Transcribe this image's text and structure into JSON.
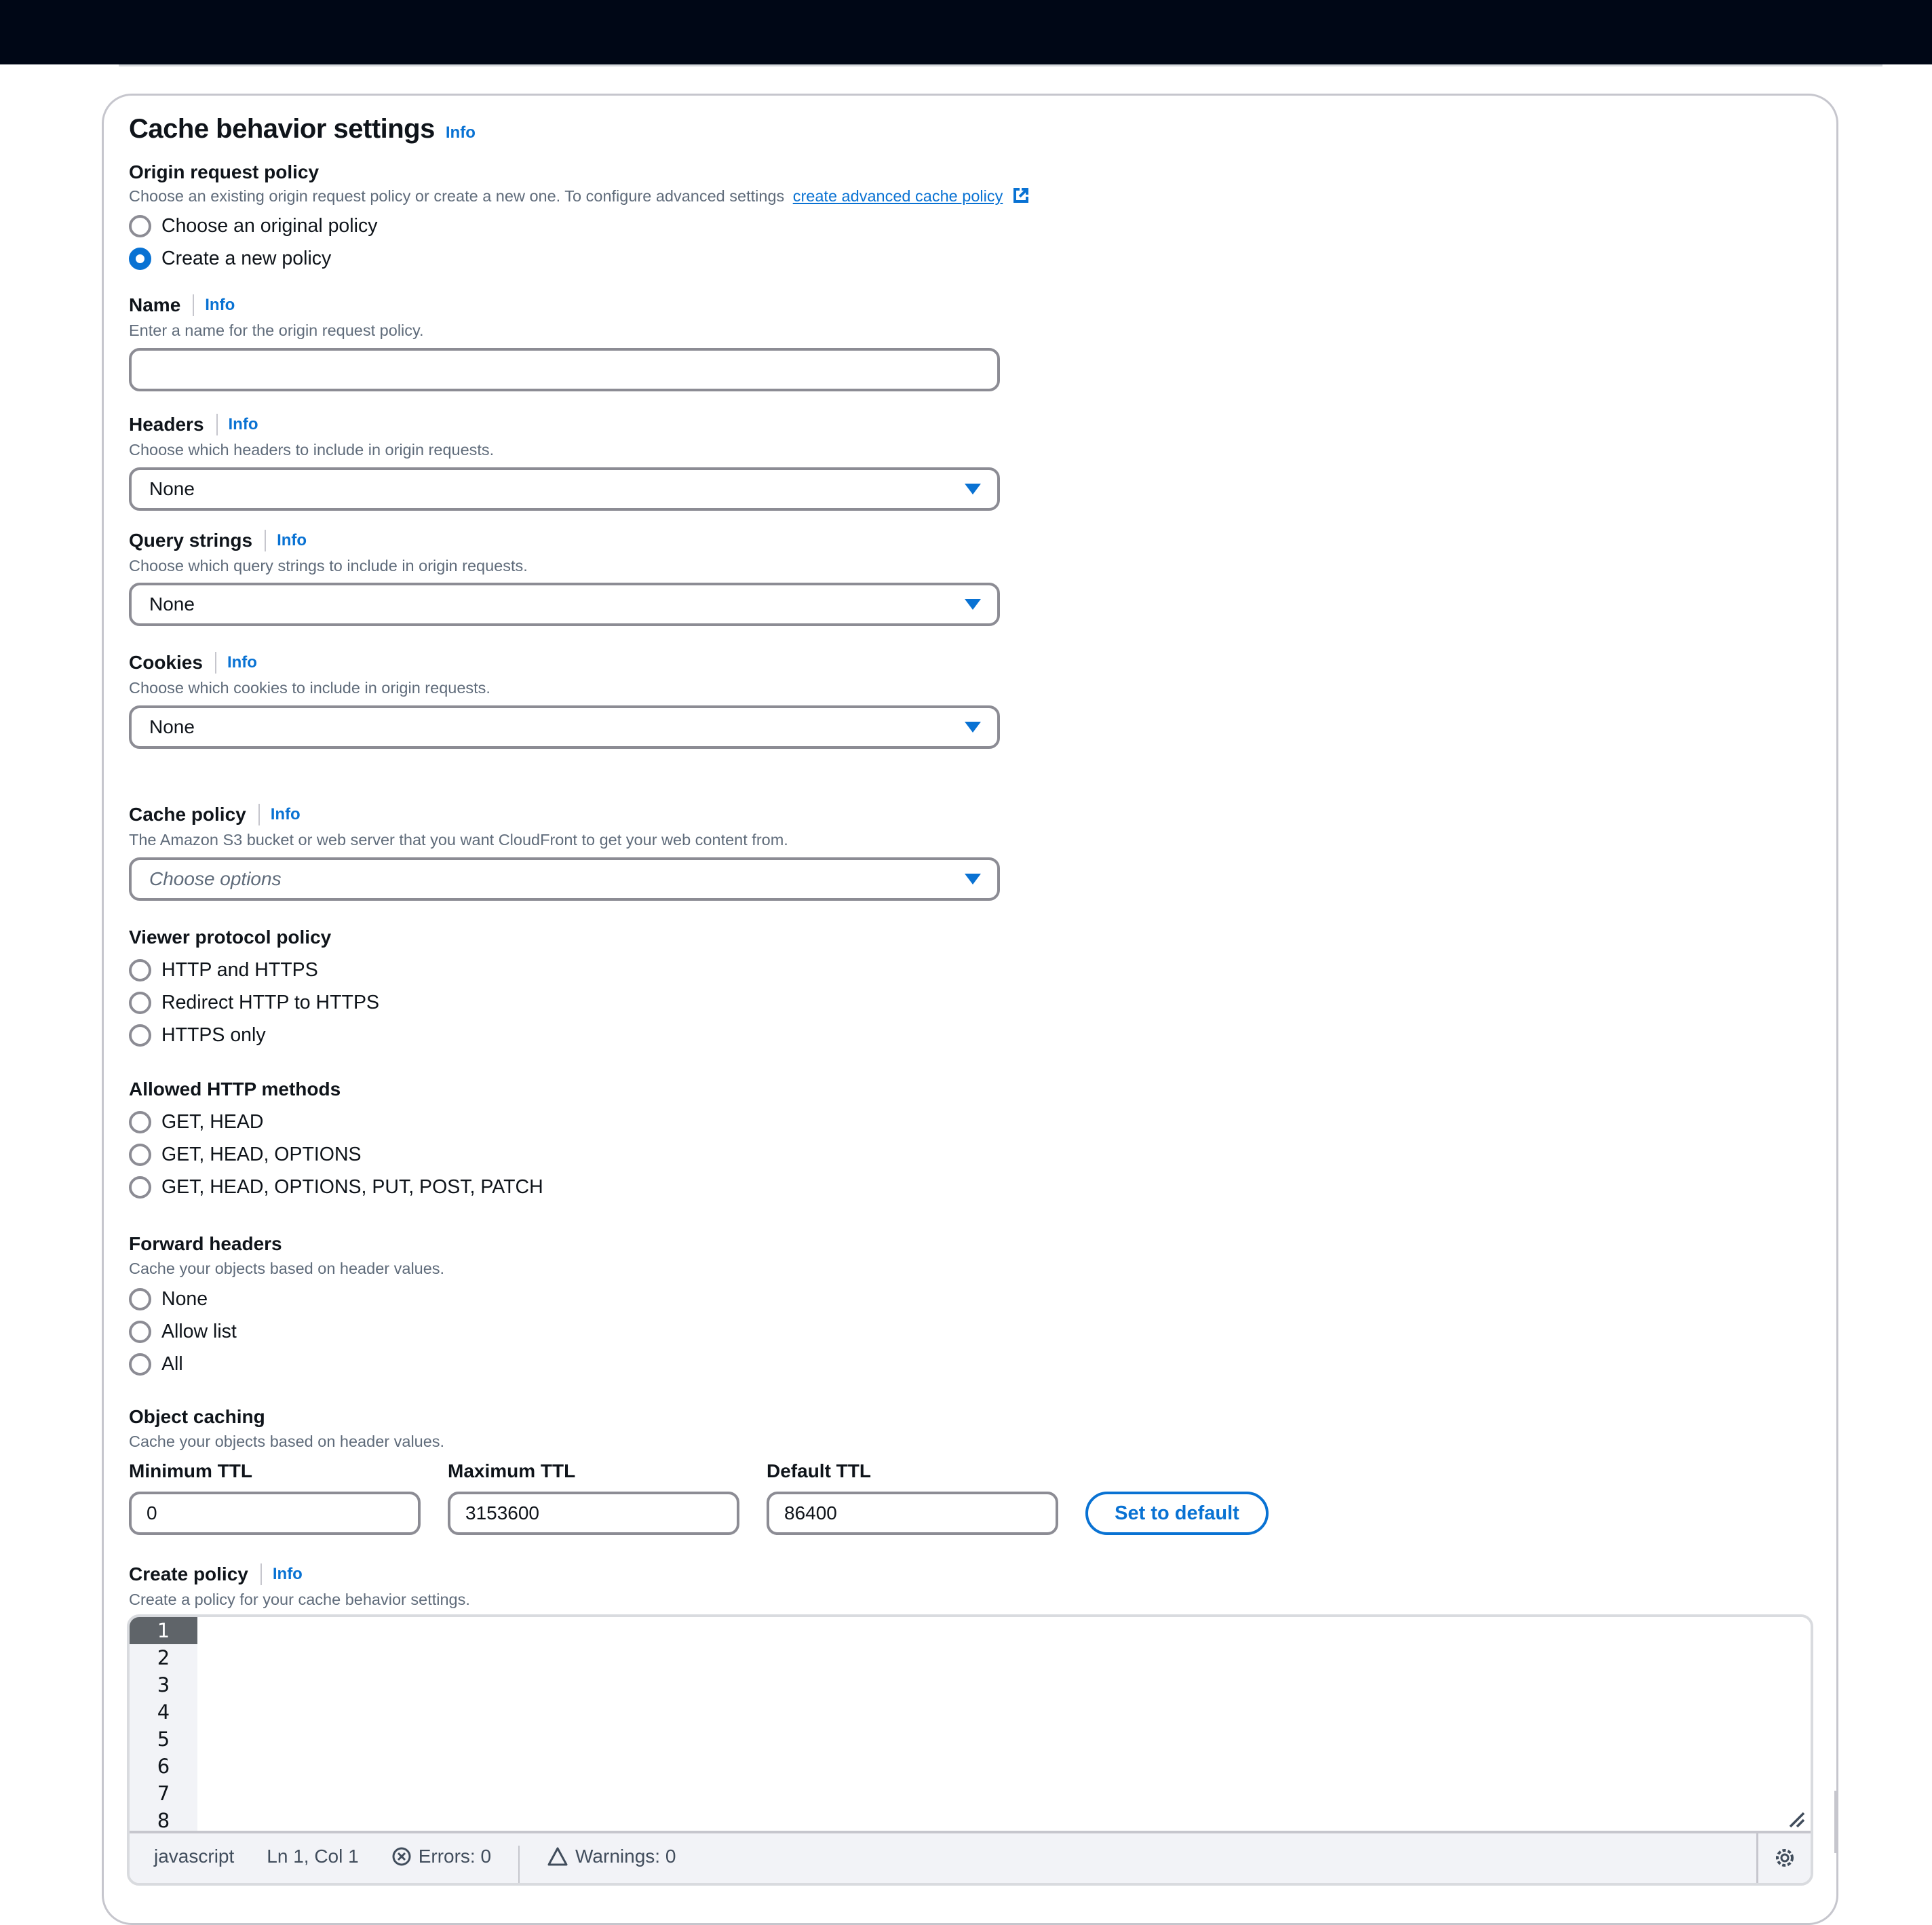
{
  "section": {
    "title": "Cache behavior settings",
    "info_label": "Info"
  },
  "origin_request_policy": {
    "label": "Origin request policy",
    "description": "Choose an existing origin request policy or create a new one. To configure advanced settings",
    "link_text": "create advanced cache policy",
    "link_icon": "external-link-icon",
    "options": [
      {
        "label": "Choose an original policy",
        "selected": false
      },
      {
        "label": "Create a new policy",
        "selected": true
      }
    ]
  },
  "name_field": {
    "label": "Name",
    "info_label": "Info",
    "description": "Enter a name for the origin request policy.",
    "value": "",
    "placeholder": ""
  },
  "headers_field": {
    "label": "Headers",
    "info_label": "Info",
    "description": "Choose which headers to include in origin requests.",
    "selected": "None",
    "icon": "caret-down-icon"
  },
  "query_strings_field": {
    "label": "Query strings",
    "info_label": "Info",
    "description": "Choose which query strings to include in origin requests.",
    "selected": "None"
  },
  "cookies_field": {
    "label": "Cookies",
    "info_label": "Info",
    "description": "Choose which cookies to include in origin requests.",
    "selected": "None"
  },
  "cache_policy_field": {
    "label": "Cache policy",
    "info_label": "Info",
    "description": "The Amazon S3 bucket or web server that you want CloudFront to get your web content from.",
    "placeholder": "Choose options"
  },
  "viewer_protocol_policy": {
    "label": "Viewer protocol policy",
    "options": [
      {
        "label": "HTTP and HTTPS",
        "selected": false
      },
      {
        "label": "Redirect HTTP to HTTPS",
        "selected": false
      },
      {
        "label": "HTTPS only",
        "selected": false
      }
    ]
  },
  "allowed_http_methods": {
    "label": "Allowed HTTP methods",
    "options": [
      {
        "label": "GET, HEAD",
        "selected": false
      },
      {
        "label": "GET, HEAD, OPTIONS",
        "selected": false
      },
      {
        "label": "GET, HEAD, OPTIONS, PUT, POST, PATCH",
        "selected": false
      }
    ]
  },
  "forward_headers": {
    "label": "Forward headers",
    "description": "Cache your objects based on header values.",
    "options": [
      {
        "label": "None",
        "selected": false
      },
      {
        "label": "Allow list",
        "selected": false
      },
      {
        "label": "All",
        "selected": false
      }
    ]
  },
  "object_caching": {
    "label": "Object caching",
    "description": "Cache your objects based on header values.",
    "min_ttl": {
      "label": "Minimum TTL",
      "value": "0"
    },
    "max_ttl": {
      "label": "Maximum TTL",
      "value": "3153600"
    },
    "default_ttl": {
      "label": "Default TTL",
      "value": "86400"
    },
    "set_default_label": "Set to default"
  },
  "create_policy": {
    "label": "Create policy",
    "info_label": "Info",
    "description": "Create a policy for your cache behavior settings.",
    "line_numbers": [
      "1",
      "2",
      "3",
      "4",
      "5",
      "6",
      "7",
      "8"
    ],
    "active_line": 1,
    "status": {
      "language": "javascript",
      "position": "Ln 1, Col 1",
      "errors_label": "Errors: 0",
      "warnings_label": "Warnings: 0"
    }
  },
  "colors": {
    "accent": "#0972d3",
    "topbar": "#000716",
    "border": "#8c8c94",
    "text": "#0f141a",
    "muted": "#5f6b7a"
  }
}
